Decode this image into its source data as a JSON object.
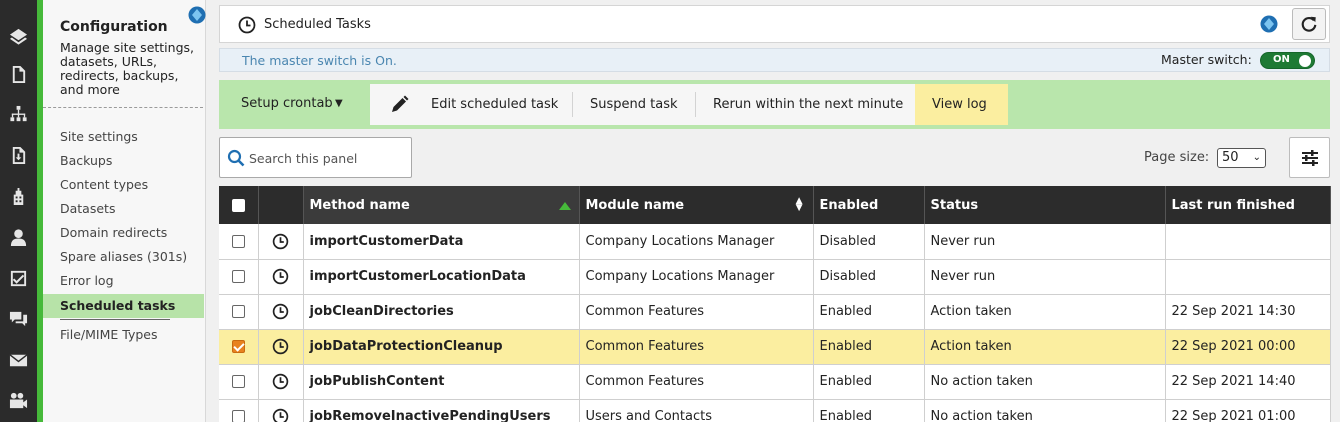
{
  "rail": {
    "icons": [
      "layers-icon",
      "document-icon",
      "sitemap-icon",
      "download-doc-icon",
      "building-icon",
      "user-icon",
      "checklist-icon",
      "chat-icon",
      "mail-icon",
      "video-icon"
    ]
  },
  "config": {
    "title": "Configuration",
    "description": "Manage site settings, datasets, URLs, redirects, backups, and more",
    "items": [
      {
        "label": "Site settings"
      },
      {
        "label": "Backups"
      },
      {
        "label": "Content types"
      },
      {
        "label": "Datasets"
      },
      {
        "label": "Domain redirects"
      },
      {
        "label": "Spare aliases (301s)"
      },
      {
        "label": "Error log"
      },
      {
        "label": "Scheduled tasks",
        "active": true
      },
      {
        "label": "File/MIME Types"
      }
    ]
  },
  "header": {
    "title": "Scheduled Tasks"
  },
  "master": {
    "message": "The master switch is On.",
    "label": "Master switch:",
    "toggle": "ON"
  },
  "toolbar": {
    "crontab": "Setup crontab",
    "edit": "Edit scheduled task",
    "suspend": "Suspend task",
    "rerun": "Rerun within the next minute",
    "viewlog": "View log"
  },
  "search": {
    "placeholder": "Search this panel"
  },
  "pagesize": {
    "label": "Page size:",
    "value": "50"
  },
  "table": {
    "columns": [
      "Method name",
      "Module name",
      "Enabled",
      "Status",
      "Last run finished"
    ],
    "rows": [
      {
        "method": "importCustomerData",
        "module": "Company Locations Manager",
        "enabled": "Disabled",
        "status": "Never run",
        "last": "",
        "checked": false
      },
      {
        "method": "importCustomerLocationData",
        "module": "Company Locations Manager",
        "enabled": "Disabled",
        "status": "Never run",
        "last": "",
        "checked": false
      },
      {
        "method": "jobCleanDirectories",
        "module": "Common Features",
        "enabled": "Enabled",
        "status": "Action taken",
        "last": "22 Sep 2021 14:30",
        "checked": false
      },
      {
        "method": "jobDataProtectionCleanup",
        "module": "Common Features",
        "enabled": "Enabled",
        "status": "Action taken",
        "last": "22 Sep 2021 00:00",
        "checked": true
      },
      {
        "method": "jobPublishContent",
        "module": "Common Features",
        "enabled": "Enabled",
        "status": "No action taken",
        "last": "22 Sep 2021 14:40",
        "checked": false
      },
      {
        "method": "jobRemoveInactivePendingUsers",
        "module": "Users and Contacts",
        "enabled": "Enabled",
        "status": "No action taken",
        "last": "22 Sep 2021 01:00",
        "checked": false
      }
    ]
  }
}
